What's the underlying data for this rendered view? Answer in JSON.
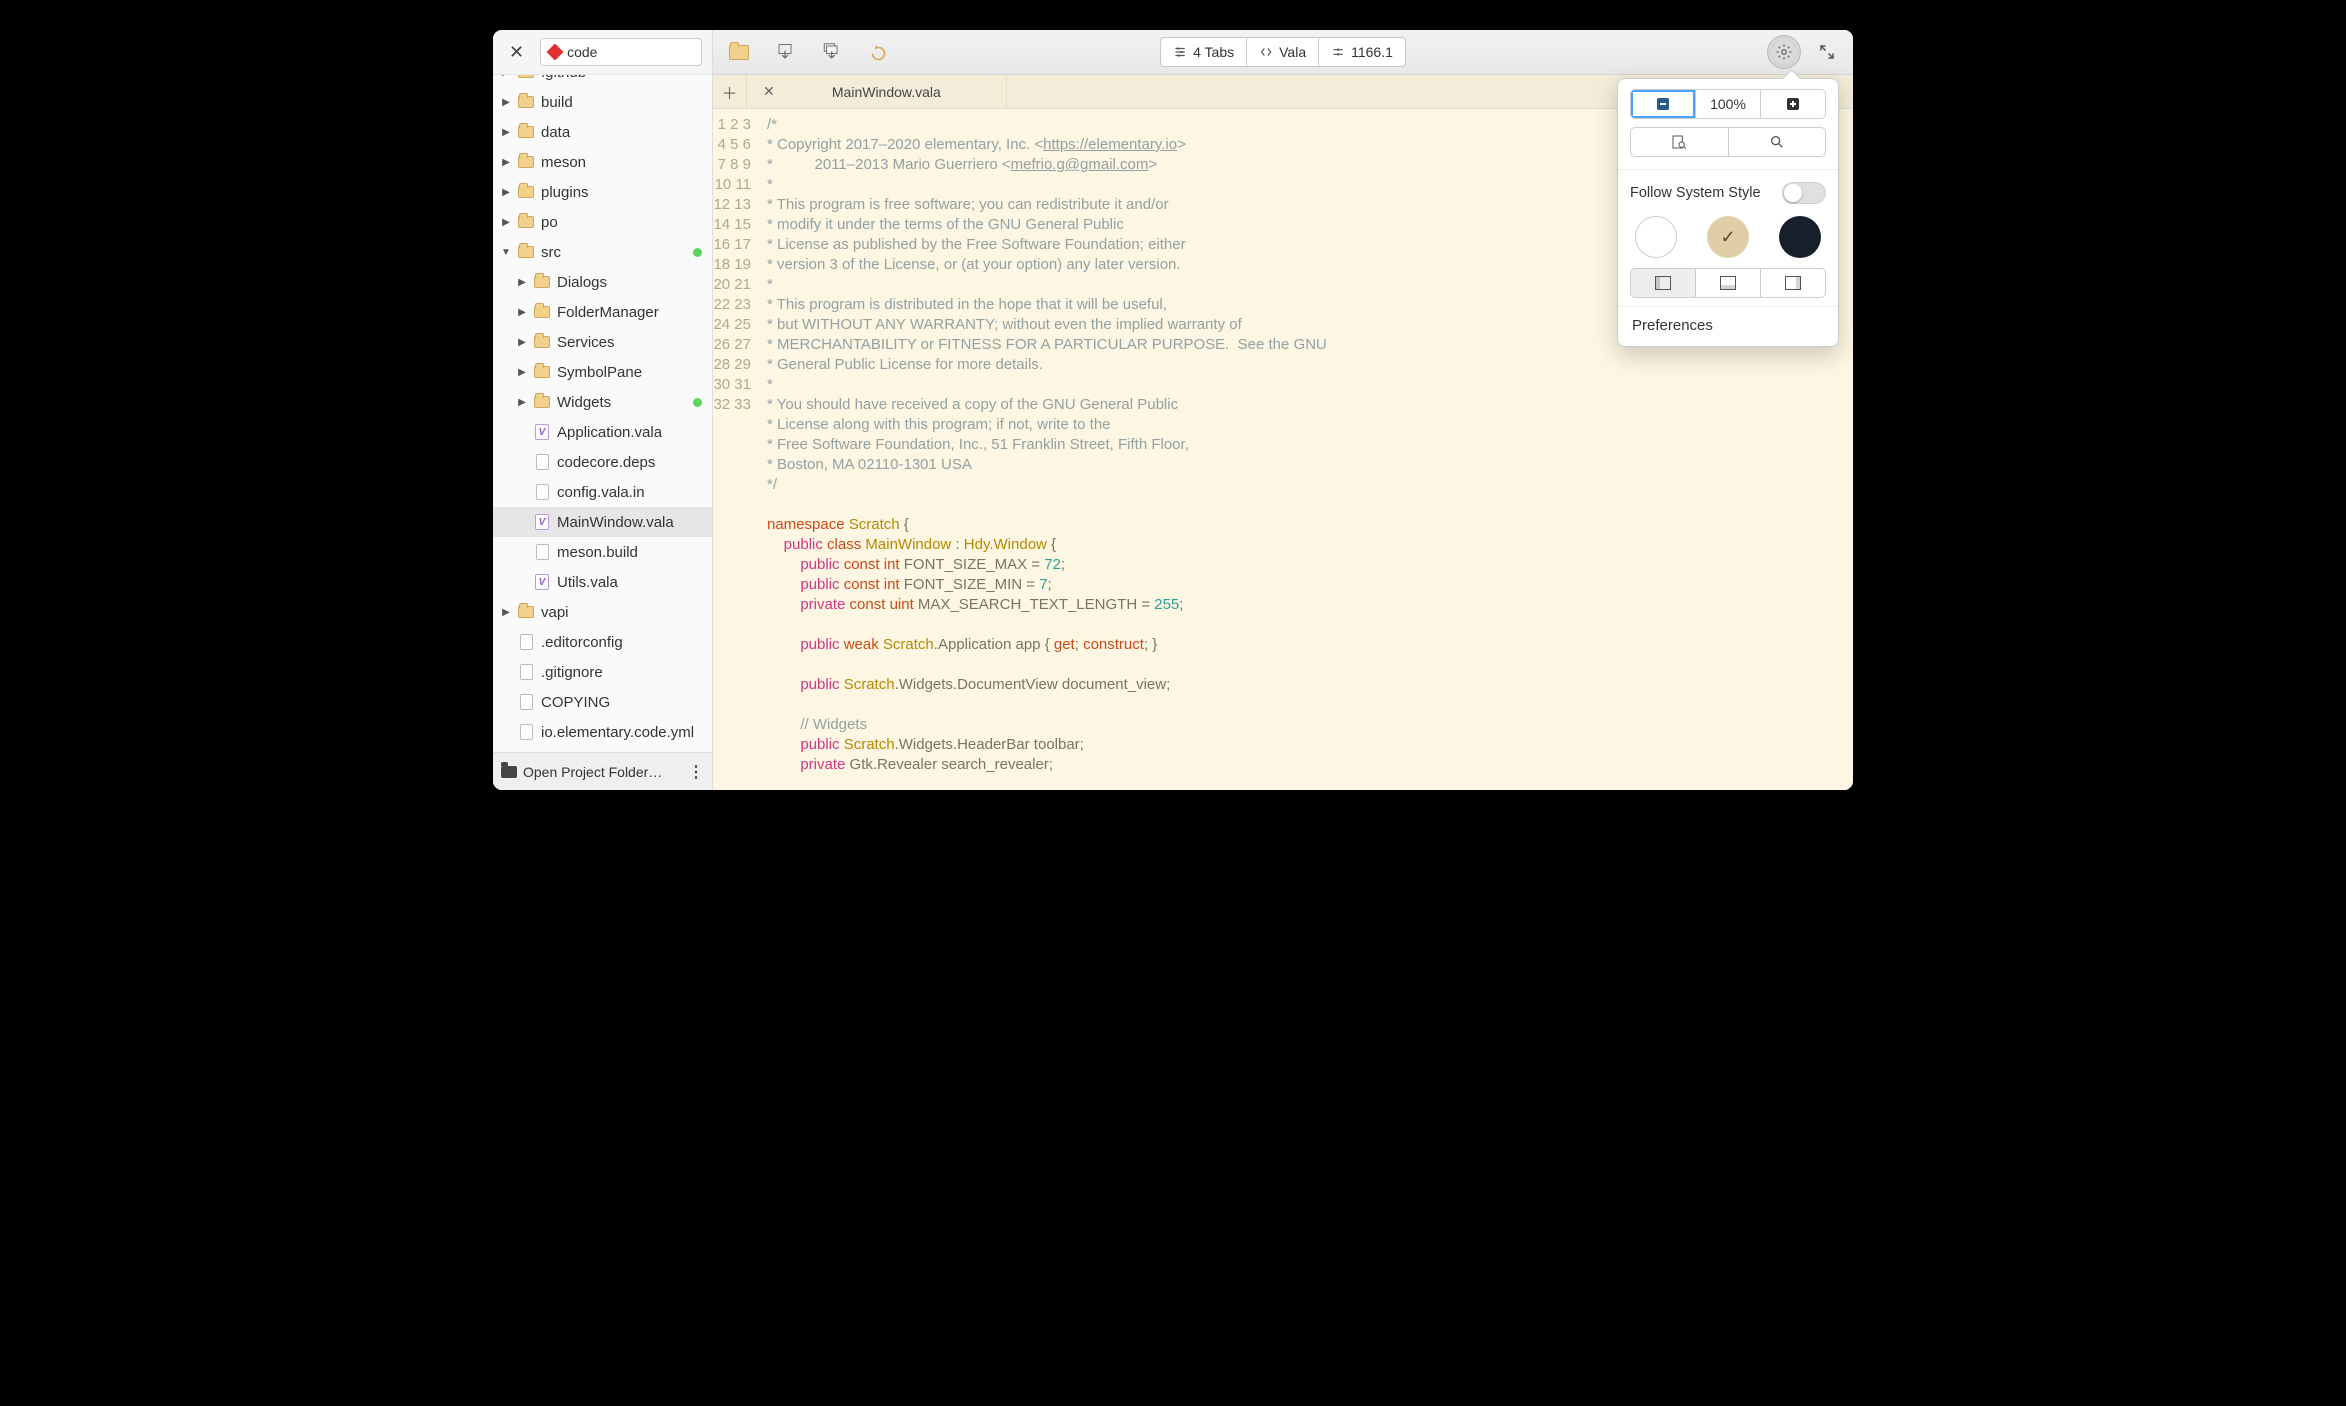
{
  "sidebar": {
    "location_label": "code",
    "footer_label": "Open Project Folder…",
    "tree": [
      {
        "label": ".github",
        "type": "folder",
        "collapsed": true,
        "depth": 0,
        "cut": true
      },
      {
        "label": "build",
        "type": "folder",
        "collapsed": true,
        "depth": 0
      },
      {
        "label": "data",
        "type": "folder",
        "collapsed": true,
        "depth": 0
      },
      {
        "label": "meson",
        "type": "folder",
        "collapsed": true,
        "depth": 0
      },
      {
        "label": "plugins",
        "type": "folder",
        "collapsed": true,
        "depth": 0
      },
      {
        "label": "po",
        "type": "folder",
        "collapsed": true,
        "depth": 0
      },
      {
        "label": "src",
        "type": "folder",
        "collapsed": false,
        "depth": 0,
        "dot": true
      },
      {
        "label": "Dialogs",
        "type": "folder",
        "collapsed": true,
        "depth": 1
      },
      {
        "label": "FolderManager",
        "type": "folder",
        "collapsed": true,
        "depth": 1
      },
      {
        "label": "Services",
        "type": "folder",
        "collapsed": true,
        "depth": 1
      },
      {
        "label": "SymbolPane",
        "type": "folder",
        "collapsed": true,
        "depth": 1
      },
      {
        "label": "Widgets",
        "type": "folder",
        "collapsed": true,
        "depth": 1,
        "dot": true
      },
      {
        "label": "Application.vala",
        "type": "vala",
        "depth": 1
      },
      {
        "label": "codecore.deps",
        "type": "file",
        "depth": 1
      },
      {
        "label": "config.vala.in",
        "type": "file",
        "depth": 1
      },
      {
        "label": "MainWindow.vala",
        "type": "vala",
        "depth": 1,
        "selected": true
      },
      {
        "label": "meson.build",
        "type": "file",
        "depth": 1
      },
      {
        "label": "Utils.vala",
        "type": "vala",
        "depth": 1
      },
      {
        "label": "vapi",
        "type": "folder",
        "collapsed": true,
        "depth": 0
      },
      {
        "label": ".editorconfig",
        "type": "file",
        "depth": 0
      },
      {
        "label": ".gitignore",
        "type": "file",
        "depth": 0
      },
      {
        "label": "COPYING",
        "type": "file",
        "depth": 0
      },
      {
        "label": "io.elementary.code.yml",
        "type": "file",
        "depth": 0
      }
    ]
  },
  "headerbar": {
    "tabs_label": "4 Tabs",
    "lang_label": "Vala",
    "linecol": "1166.1"
  },
  "tabs": {
    "current": "MainWindow.vala"
  },
  "popover": {
    "zoom": "100%",
    "follow_style": "Follow System Style",
    "preferences": "Preferences",
    "theme_check": "✓"
  },
  "editor": {
    "first_line": 1,
    "links": {
      "elementary": "https://elementary.io",
      "mefrio": "mefrio.g@gmail.com"
    },
    "lines": [
      "/*",
      "* Copyright 2017–2020 elementary, Inc. <https://elementary.io>",
      "*          2011–2013 Mario Guerriero <mefrio.g@gmail.com>",
      "*",
      "* This program is free software; you can redistribute it and/or",
      "* modify it under the terms of the GNU General Public",
      "* License as published by the Free Software Foundation; either",
      "* version 3 of the License, or (at your option) any later version.",
      "*",
      "* This program is distributed in the hope that it will be useful,",
      "* but WITHOUT ANY WARRANTY; without even the implied warranty of",
      "* MERCHANTABILITY or FITNESS FOR A PARTICULAR PURPOSE.  See the GNU",
      "* General Public License for more details.",
      "*",
      "* You should have received a copy of the GNU General Public",
      "* License along with this program; if not, write to the",
      "* Free Software Foundation, Inc., 51 Franklin Street, Fifth Floor,",
      "* Boston, MA 02110-1301 USA",
      "*/",
      "",
      "namespace Scratch {",
      "    public class MainWindow : Hdy.Window {",
      "        public const int FONT_SIZE_MAX = 72;",
      "        public const int FONT_SIZE_MIN = 7;",
      "        private const uint MAX_SEARCH_TEXT_LENGTH = 255;",
      "",
      "        public weak Scratch.Application app { get; construct; }",
      "",
      "        public Scratch.Widgets.DocumentView document_view;",
      "",
      "        // Widgets",
      "        public Scratch.Widgets.HeaderBar toolbar;",
      "        private Gtk.Revealer search_revealer;"
    ]
  }
}
